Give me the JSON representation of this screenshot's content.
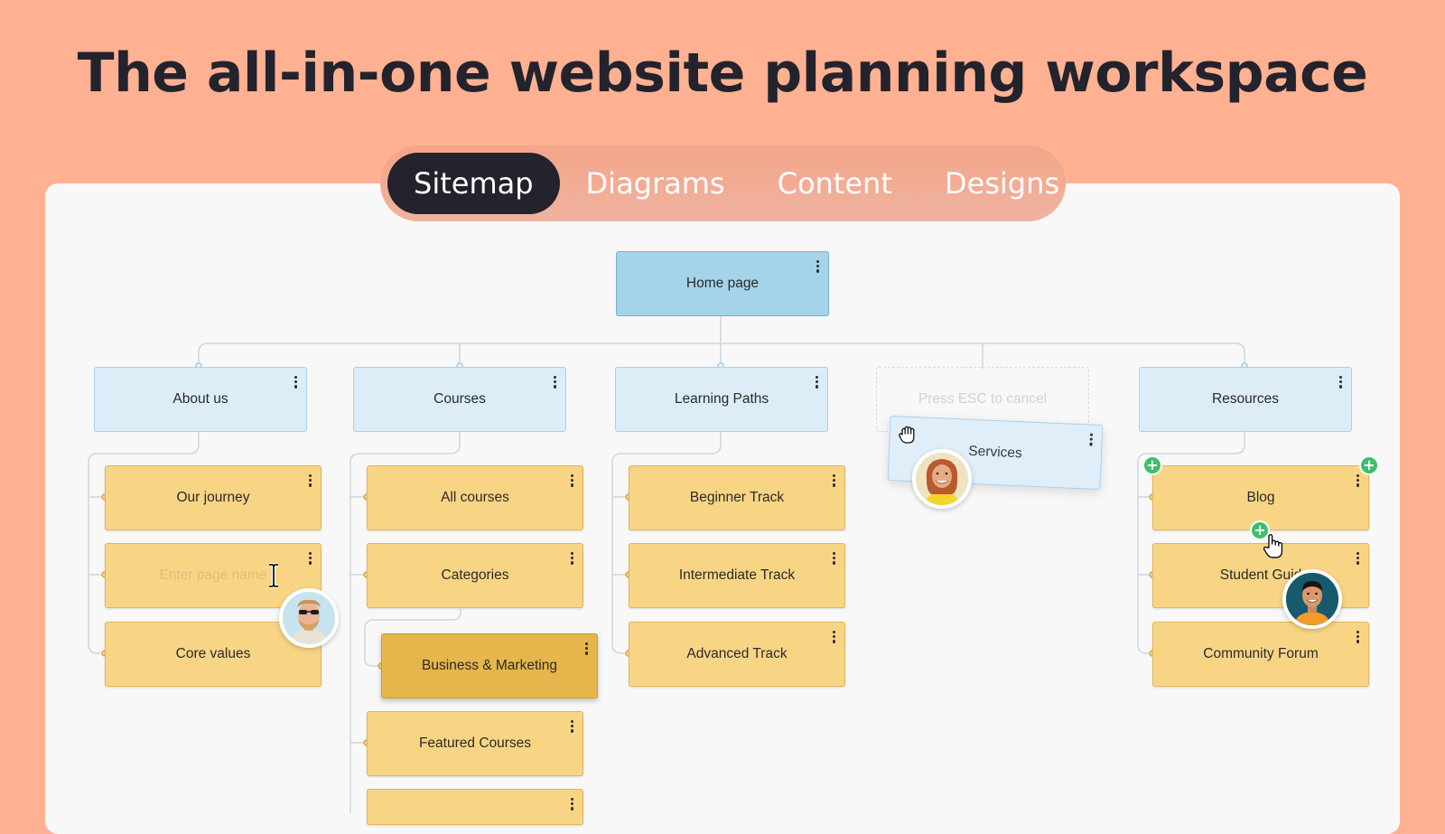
{
  "headline": "The all-in-one website planning workspace",
  "tabs": [
    {
      "label": "Sitemap",
      "active": true
    },
    {
      "label": "Diagrams",
      "active": false
    },
    {
      "label": "Content",
      "active": false
    },
    {
      "label": "Designs",
      "active": false
    }
  ],
  "sitemap": {
    "home": "Home page",
    "sections": {
      "about": {
        "label": "About us",
        "pages": [
          "Our journey",
          "Core values"
        ],
        "editing_placeholder": "Enter page name"
      },
      "courses": {
        "label": "Courses",
        "pages": [
          "All courses",
          "Categories",
          "Business & Marketing",
          "Featured Courses",
          ""
        ]
      },
      "paths": {
        "label": "Learning Paths",
        "pages": [
          "Beginner Track",
          "Intermediate Track",
          "Advanced Track"
        ]
      },
      "drop": {
        "hint": "Press ESC to cancel",
        "dragging": "Services"
      },
      "resources": {
        "label": "Resources",
        "pages": [
          "Blog",
          "Student Guid",
          "Community Forum"
        ]
      }
    }
  },
  "colors": {
    "background": "#FFB192",
    "home_node": "#a5d3ea",
    "section_node": "#dcedf8",
    "page_node": "#f8d585",
    "selected_node": "#e5b64b",
    "add_button": "#3fbf6a"
  },
  "icons": [
    "more-vertical-icon",
    "plus-icon",
    "text-cursor-icon",
    "grab-hand-icon",
    "pointer-hand-icon"
  ]
}
